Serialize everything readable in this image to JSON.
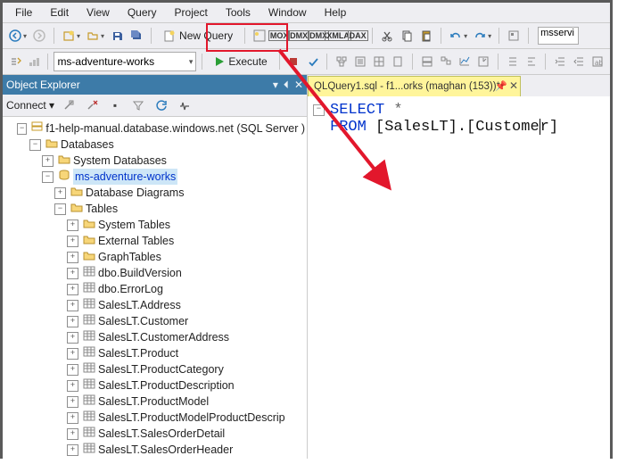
{
  "menubar": [
    "File",
    "Edit",
    "View",
    "Query",
    "Project",
    "Tools",
    "Window",
    "Help"
  ],
  "toolbar": {
    "newQuery": "New Query",
    "msField": "msservi"
  },
  "toolbar2": {
    "dbSelected": "ms-adventure-works",
    "execute": "Execute"
  },
  "objectExplorer": {
    "title": "Object Explorer",
    "connectLabel": "Connect",
    "server": "f1-help-manual.database.windows.net (SQL Server )",
    "databases": "Databases",
    "systemDatabases": "System Databases",
    "dbName": "ms-adventure-works",
    "diagrams": "Database Diagrams",
    "tablesFolder": "Tables",
    "systemTables": "System Tables",
    "externalTables": "External Tables",
    "graphTables": "GraphTables",
    "tables": [
      "dbo.BuildVersion",
      "dbo.ErrorLog",
      "SalesLT.Address",
      "SalesLT.Customer",
      "SalesLT.CustomerAddress",
      "SalesLT.Product",
      "SalesLT.ProductCategory",
      "SalesLT.ProductDescription",
      "SalesLT.ProductModel",
      "SalesLT.ProductModelProductDescrip",
      "SalesLT.SalesOrderDetail",
      "SalesLT.SalesOrderHeader"
    ]
  },
  "editor": {
    "tabTitle": "QLQuery1.sql - f1...orks (maghan (153))*",
    "code": {
      "kwSelect": "SELECT",
      "star": "*",
      "kwFrom": "FROM",
      "table1": "[SalesLT].[Custome",
      "table2": "r]"
    }
  },
  "xmla": [
    "MOX",
    "DMX",
    "DMX",
    "XMLA",
    "DAX"
  ]
}
